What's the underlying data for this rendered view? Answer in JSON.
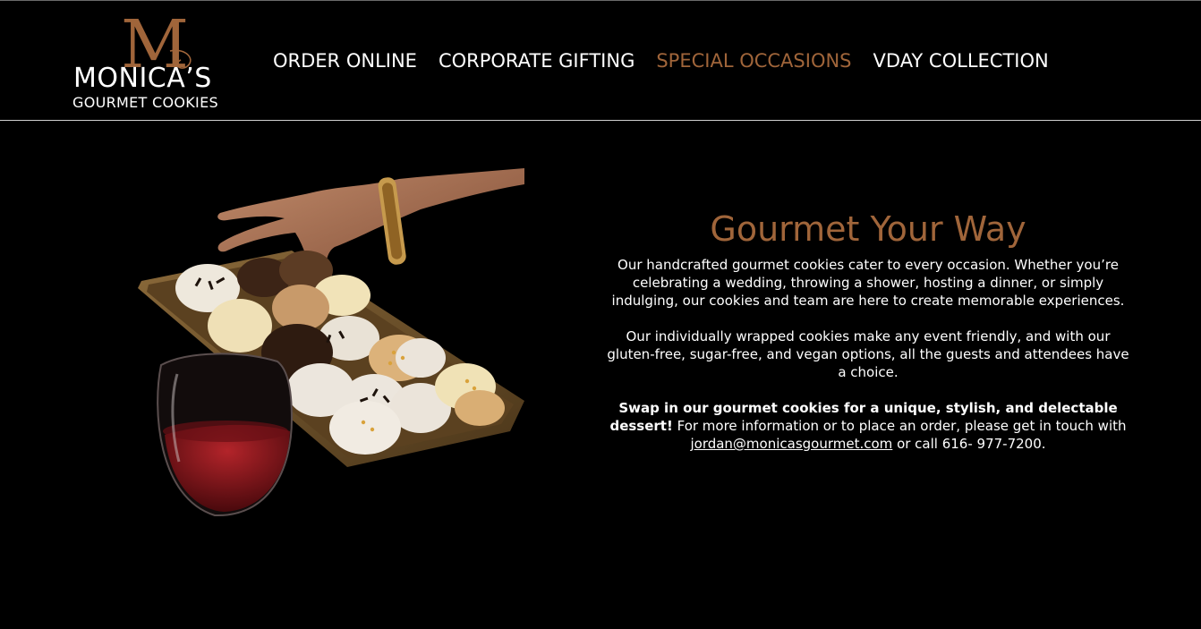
{
  "brand": {
    "monogram": "M",
    "name": "MONICA’S",
    "tagline": "GOURMET COOKIES",
    "brown": "#a0653a"
  },
  "nav": {
    "items": [
      {
        "label": "ORDER ONLINE",
        "active": false
      },
      {
        "label": "CORPORATE GIFTING",
        "active": false
      },
      {
        "label": "SPECIAL OCCASIONS",
        "active": true
      },
      {
        "label": "VDAY COLLECTION",
        "active": false
      }
    ]
  },
  "hero": {
    "image_alt": "hand-reaching-for-cookies-with-wine-glass"
  },
  "main": {
    "title": "Gourmet Your Way",
    "paragraph1": "Our handcrafted gourmet cookies cater to every occasion. Whether you’re celebrating a wedding, throwing a shower, hosting a dinner, or simply indulging, our cookies and team are here to create memorable experiences.",
    "paragraph2": "Our individually wrapped cookies make any event friendly, and with our gluten-free, sugar-free, and vegan options, all the guests and attendees have a choice.",
    "cta_bold": "Swap in our gourmet cookies for a unique, stylish, and delectable dessert!",
    "cta_text": " For more information or to place an order, please get in touch with ",
    "email": "jordan@monicasgourmet.com",
    "phone_text": " or call 616- 977-7200."
  }
}
